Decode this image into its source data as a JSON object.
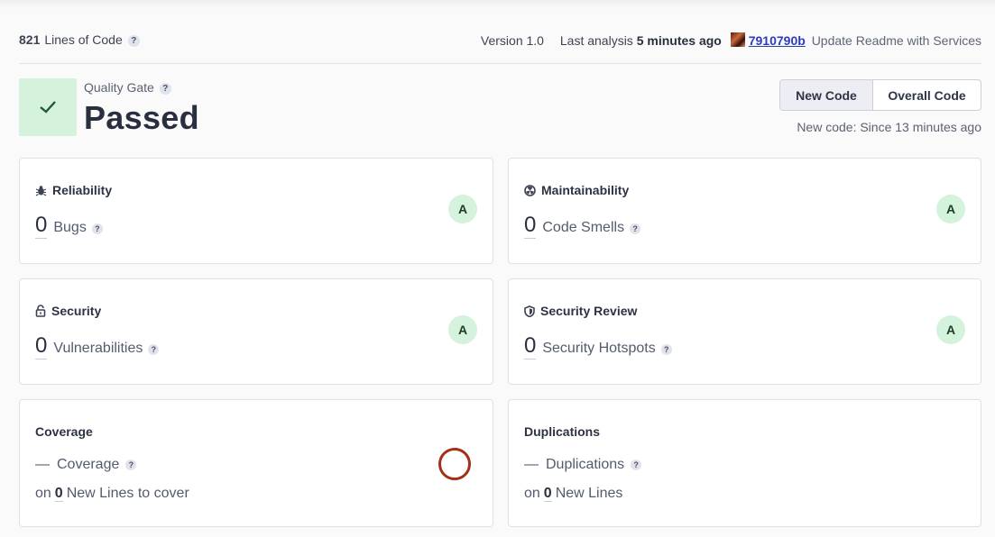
{
  "meta": {
    "loc_count": "821",
    "loc_label": "Lines of Code",
    "version": "Version 1.0",
    "last_analysis_label": "Last analysis",
    "last_analysis_value": "5 minutes ago",
    "commit_hash": "7910790b",
    "commit_message": "Update Readme with Services"
  },
  "quality_gate": {
    "label": "Quality Gate",
    "status": "Passed",
    "status_color": "#d4f2dc"
  },
  "toggle": {
    "new_code": "New Code",
    "overall_code": "Overall Code",
    "selected": "New Code",
    "since": "New code: Since 13 minutes ago"
  },
  "cards": {
    "reliability": {
      "title": "Reliability",
      "value": "0",
      "metric": "Bugs",
      "rating": "A",
      "icon": "bug-icon"
    },
    "maintainability": {
      "title": "Maintainability",
      "value": "0",
      "metric": "Code Smells",
      "rating": "A",
      "icon": "smell-icon"
    },
    "security": {
      "title": "Security",
      "value": "0",
      "metric": "Vulnerabilities",
      "rating": "A",
      "icon": "lock-icon"
    },
    "security_review": {
      "title": "Security Review",
      "value": "0",
      "metric": "Security Hotspots",
      "rating": "A",
      "icon": "shield-icon"
    },
    "coverage": {
      "title": "Coverage",
      "value": "—",
      "metric": "Coverage",
      "on_prefix": "on",
      "on_count": "0",
      "on_label": "New Lines to cover",
      "ring_color": "#a5301a"
    },
    "duplications": {
      "title": "Duplications",
      "value": "—",
      "metric": "Duplications",
      "on_prefix": "on",
      "on_count": "0",
      "on_label": "New Lines"
    }
  },
  "help_glyph": "?",
  "rating_color": "#d4f2dc"
}
